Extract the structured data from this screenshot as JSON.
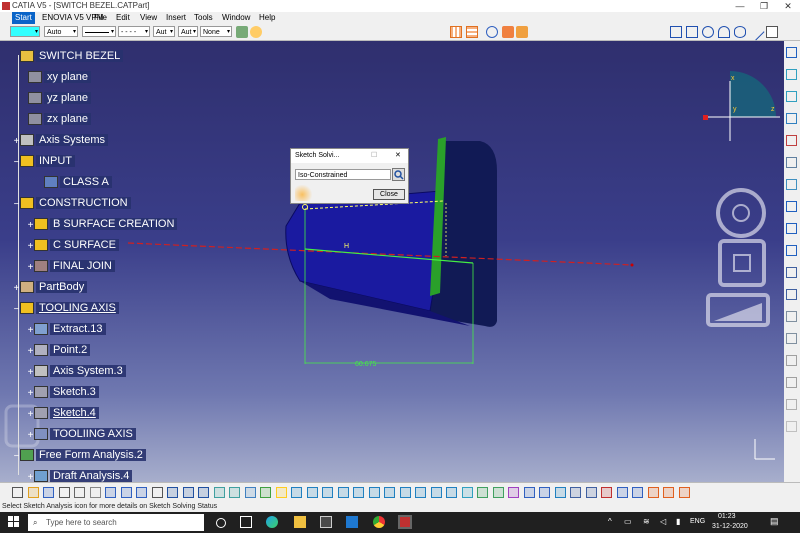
{
  "window": {
    "title": "CATIA V5 - [SWITCH BEZEL.CATPart]",
    "minimize": "—",
    "restore": "❐",
    "close": "✕"
  },
  "menu": [
    "Start",
    "ENOVIA V5 VPM",
    "File",
    "Edit",
    "View",
    "Insert",
    "Tools",
    "Window",
    "Help"
  ],
  "toolbar": {
    "color_value": "",
    "transparency": "Auto",
    "thickness": "",
    "linetype": "- - - -",
    "weight": "Aut",
    "point": "Aut",
    "layer": "None"
  },
  "tree": [
    {
      "label": "SWITCH BEZEL",
      "icon": "part-icon"
    },
    {
      "label": "xy plane",
      "icon": "plane-icon"
    },
    {
      "label": "yz plane",
      "icon": "plane-icon"
    },
    {
      "label": "zx plane",
      "icon": "plane-icon"
    },
    {
      "label": "Axis Systems",
      "icon": "axis-system-icon"
    },
    {
      "label": "INPUT",
      "icon": "geometrical-set-icon"
    },
    {
      "label": "CLASS A",
      "icon": "surface-icon"
    },
    {
      "label": "CONSTRUCTION",
      "icon": "geometrical-set-icon"
    },
    {
      "label": "B SURFACE CREATION",
      "icon": "geometrical-set-icon"
    },
    {
      "label": "C SURFACE",
      "icon": "geometrical-set-icon"
    },
    {
      "label": "FINAL JOIN",
      "icon": "join-icon"
    },
    {
      "label": "PartBody",
      "icon": "body-icon"
    },
    {
      "label": "TOOLING AXIS",
      "icon": "geometrical-set-icon"
    },
    {
      "label": "Extract.13",
      "icon": "extract-icon"
    },
    {
      "label": "Point.2",
      "icon": "point-icon"
    },
    {
      "label": "Axis System.3",
      "icon": "axis-system-icon"
    },
    {
      "label": "Sketch.3",
      "icon": "sketch-icon"
    },
    {
      "label": "Sketch.4",
      "icon": "sketch-icon"
    },
    {
      "label": "TOOLIING AXIS",
      "icon": "line-icon"
    },
    {
      "label": "Free Form Analysis.2",
      "icon": "analysis-icon"
    },
    {
      "label": "Draft Analysis.4",
      "icon": "draft-analysis-icon"
    }
  ],
  "dialog": {
    "title": "Sketch Solvi...",
    "status": "Iso-Constrained",
    "close": "Close"
  },
  "viewport": {
    "dimension": "60.675",
    "axis_x": "x",
    "axis_y": "y",
    "axis_z": "z",
    "h_label": "H"
  },
  "status_bar": "Select Sketch Analysis icon for more details on Sketch Solving Status",
  "taskbar": {
    "search_placeholder": "Type here to search",
    "lang": "ENG",
    "time": "01:23",
    "date": "31-12-2020"
  },
  "colors": {
    "part_body": "#1a1aa0",
    "edge_green": "#2aa02a",
    "background_top": "#2f2f6e",
    "background_bottom": "#a7aecc"
  }
}
